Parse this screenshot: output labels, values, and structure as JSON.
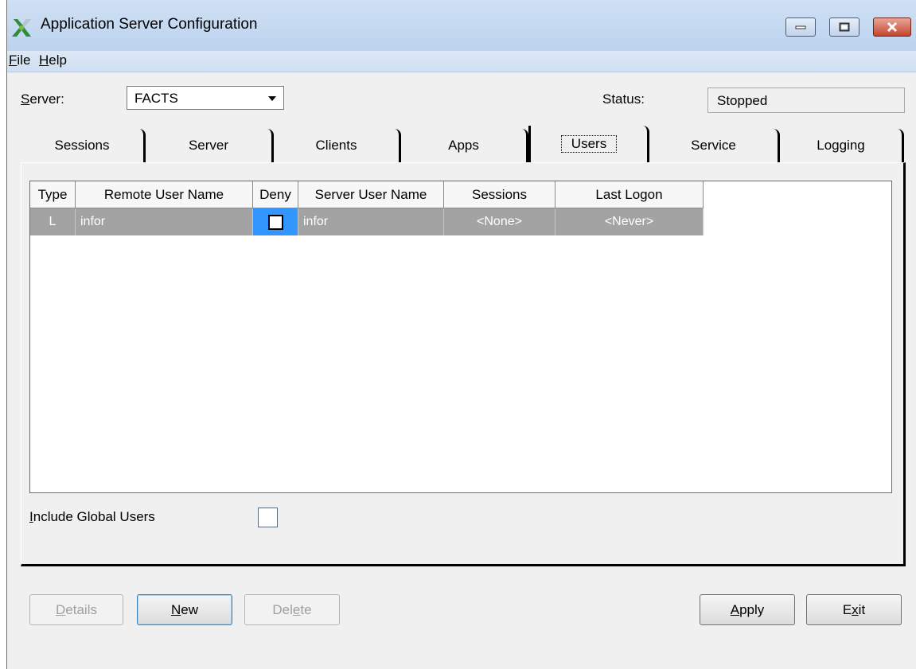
{
  "window": {
    "title": "Application Server Configuration"
  },
  "menu": {
    "file": {
      "mnemonic": "F",
      "rest": "ile"
    },
    "help": {
      "mnemonic": "H",
      "rest": "elp"
    }
  },
  "server": {
    "label_mnemonic": "S",
    "label_rest": "erver:",
    "value": "FACTS"
  },
  "status": {
    "label": "Status:",
    "value": "Stopped"
  },
  "tabs": [
    {
      "label": "Sessions"
    },
    {
      "label": "Server"
    },
    {
      "label": "Clients"
    },
    {
      "label": "Apps"
    },
    {
      "label": "Users"
    },
    {
      "label": "Service"
    },
    {
      "label": "Logging"
    }
  ],
  "active_tab": "Users",
  "grid": {
    "columns": [
      "Type",
      "Remote User Name",
      "Deny",
      "Server User Name",
      "Sessions",
      "Last Logon"
    ],
    "rows": [
      {
        "type": "L",
        "remote_user": "infor",
        "deny": false,
        "server_user": "infor",
        "sessions": "<None>",
        "last_logon": "<Never>"
      }
    ]
  },
  "include_global": {
    "label_mnemonic": "I",
    "label_rest": "nclude Global Users",
    "checked": false
  },
  "buttons": {
    "details": {
      "mnemonic": "D",
      "rest": "etails"
    },
    "new": {
      "mnemonic": "N",
      "rest": "ew"
    },
    "delete_pre": "Del",
    "delete_mnemonic": "e",
    "delete_post": "te",
    "apply": {
      "mnemonic": "A",
      "rest": "pply"
    },
    "exit_pre": "E",
    "exit_mnemonic": "x",
    "exit_post": "it"
  },
  "colors": {
    "selected_row": "#a3a3a3",
    "deny_cell": "#3296ff",
    "titlebar": "#bcd3ee"
  }
}
